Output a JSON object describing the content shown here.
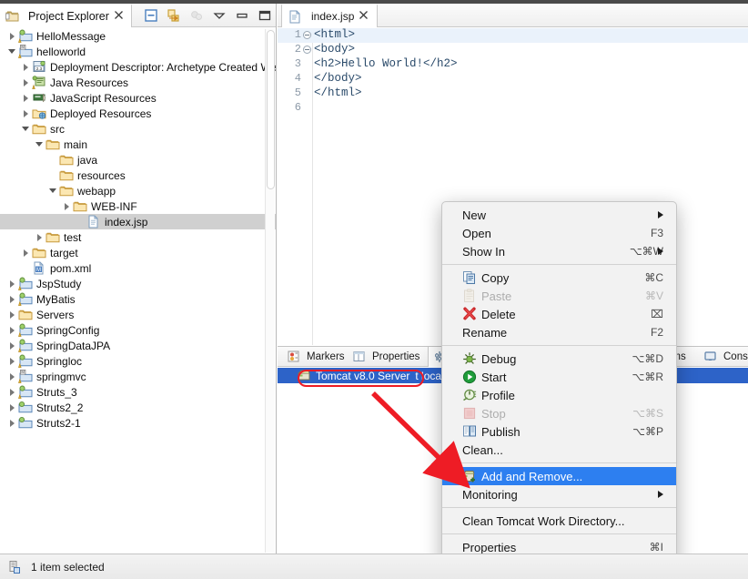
{
  "explorer": {
    "tab_title": "Project Explorer",
    "close_glyph": "✖",
    "tools": [
      "collapse-all-icon",
      "link-with-editor-icon",
      "focus-on-active-task-icon",
      "view-menu-icon",
      "minimize-icon",
      "maximize-icon"
    ],
    "tree": [
      {
        "label": "HelloMessage",
        "indent": 0,
        "arrow": "closed",
        "icon": "project-warning-icon",
        "selected": false
      },
      {
        "label": "helloworld",
        "indent": 0,
        "arrow": "open",
        "icon": "maven-project-icon",
        "selected": false
      },
      {
        "label": "Deployment Descriptor: Archetype Created We",
        "indent": 1,
        "arrow": "closed",
        "icon": "deployment-descriptor-icon",
        "selected": false
      },
      {
        "label": "Java Resources",
        "indent": 1,
        "arrow": "closed",
        "icon": "java-resources-icon",
        "selected": false
      },
      {
        "label": "JavaScript Resources",
        "indent": 1,
        "arrow": "closed",
        "icon": "javascript-resources-icon",
        "selected": false
      },
      {
        "label": "Deployed Resources",
        "indent": 1,
        "arrow": "closed",
        "icon": "deployed-resources-icon",
        "selected": false
      },
      {
        "label": "src",
        "indent": 1,
        "arrow": "open",
        "icon": "folder-icon",
        "selected": false
      },
      {
        "label": "main",
        "indent": 2,
        "arrow": "open",
        "icon": "folder-icon",
        "selected": false
      },
      {
        "label": "java",
        "indent": 3,
        "arrow": "none",
        "icon": "folder-icon",
        "selected": false
      },
      {
        "label": "resources",
        "indent": 3,
        "arrow": "none",
        "icon": "folder-icon",
        "selected": false
      },
      {
        "label": "webapp",
        "indent": 3,
        "arrow": "open",
        "icon": "folder-icon",
        "selected": false
      },
      {
        "label": "WEB-INF",
        "indent": 4,
        "arrow": "closed",
        "icon": "folder-icon",
        "selected": false
      },
      {
        "label": "index.jsp",
        "indent": 5,
        "arrow": "none",
        "icon": "jsp-file-icon",
        "selected": true
      },
      {
        "label": "test",
        "indent": 2,
        "arrow": "closed",
        "icon": "folder-icon",
        "selected": false
      },
      {
        "label": "target",
        "indent": 1,
        "arrow": "closed",
        "icon": "folder-icon",
        "selected": false
      },
      {
        "label": "pom.xml",
        "indent": 1,
        "arrow": "none",
        "icon": "maven-pom-icon",
        "selected": false
      },
      {
        "label": "JspStudy",
        "indent": 0,
        "arrow": "closed",
        "icon": "project-warning-icon",
        "selected": false
      },
      {
        "label": "MyBatis",
        "indent": 0,
        "arrow": "closed",
        "icon": "project-warning-icon",
        "selected": false
      },
      {
        "label": "Servers",
        "indent": 0,
        "arrow": "closed",
        "icon": "folder-icon",
        "selected": false
      },
      {
        "label": "SpringConfig",
        "indent": 0,
        "arrow": "closed",
        "icon": "project-warning-icon",
        "selected": false
      },
      {
        "label": "SpringDataJPA",
        "indent": 0,
        "arrow": "closed",
        "icon": "project-warning-icon",
        "selected": false
      },
      {
        "label": "Springloc",
        "indent": 0,
        "arrow": "closed",
        "icon": "project-warning-icon",
        "selected": false
      },
      {
        "label": "springmvc",
        "indent": 0,
        "arrow": "closed",
        "icon": "maven-project-icon",
        "selected": false
      },
      {
        "label": "Struts_3",
        "indent": 0,
        "arrow": "closed",
        "icon": "project-warning-icon",
        "selected": false
      },
      {
        "label": "Struts2_2",
        "indent": 0,
        "arrow": "closed",
        "icon": "project-icon",
        "selected": false
      },
      {
        "label": "Struts2-1",
        "indent": 0,
        "arrow": "closed",
        "icon": "project-icon",
        "selected": false
      }
    ]
  },
  "editor": {
    "tab_title": "index.jsp",
    "close_glyph": "✖",
    "lines": [
      {
        "num": "1",
        "fold": true,
        "text": "<html>",
        "highlight": true
      },
      {
        "num": "2",
        "fold": true,
        "text": "<body>",
        "highlight": false
      },
      {
        "num": "3",
        "fold": false,
        "text": "<h2>Hello World!</h2>",
        "highlight": false
      },
      {
        "num": "4",
        "fold": false,
        "text": "</body>",
        "highlight": false
      },
      {
        "num": "5",
        "fold": false,
        "text": "</html>",
        "highlight": false
      },
      {
        "num": "6",
        "fold": false,
        "text": "",
        "highlight": false
      }
    ]
  },
  "bottom_view": {
    "tabs": [
      {
        "label": "Markers",
        "icon": "markers-icon",
        "active": false
      },
      {
        "label": "Properties",
        "icon": "properties-icon",
        "active": false
      },
      {
        "label": "",
        "icon": "servers-icon",
        "active": true
      },
      {
        "label": "ems",
        "icon": "problems-icon",
        "active": false
      },
      {
        "label": "Cons",
        "icon": "console-icon",
        "active": false
      }
    ],
    "server_row": {
      "name": "Tomcat v8.0 Server",
      "state": "t loca",
      "icon": "tomcat-server-icon"
    }
  },
  "context_menu": {
    "items": [
      {
        "label": "New",
        "key": "",
        "icon": "",
        "submenu": true,
        "disabled": false,
        "highlighted": false
      },
      {
        "label": "Open",
        "key": "F3",
        "icon": "",
        "submenu": false,
        "disabled": false,
        "highlighted": false
      },
      {
        "label": "Show In",
        "key": "⌥⌘W",
        "icon": "",
        "submenu": true,
        "disabled": false,
        "highlighted": false
      },
      {
        "separator": true
      },
      {
        "label": "Copy",
        "key": "⌘C",
        "icon": "copy-icon",
        "submenu": false,
        "disabled": false,
        "highlighted": false
      },
      {
        "label": "Paste",
        "key": "⌘V",
        "icon": "paste-icon",
        "submenu": false,
        "disabled": true,
        "highlighted": false
      },
      {
        "label": "Delete",
        "key": "⌧",
        "icon": "delete-icon",
        "submenu": false,
        "disabled": false,
        "highlighted": false
      },
      {
        "label": "Rename",
        "key": "F2",
        "icon": "",
        "submenu": false,
        "disabled": false,
        "highlighted": false
      },
      {
        "separator": true
      },
      {
        "label": "Debug",
        "key": "⌥⌘D",
        "icon": "debug-icon",
        "submenu": false,
        "disabled": false,
        "highlighted": false
      },
      {
        "label": "Start",
        "key": "⌥⌘R",
        "icon": "start-icon",
        "submenu": false,
        "disabled": false,
        "highlighted": false
      },
      {
        "label": "Profile",
        "key": "",
        "icon": "profile-icon",
        "submenu": false,
        "disabled": false,
        "highlighted": false
      },
      {
        "label": "Stop",
        "key": "⌥⌘S",
        "icon": "stop-icon",
        "submenu": false,
        "disabled": true,
        "highlighted": false
      },
      {
        "label": "Publish",
        "key": "⌥⌘P",
        "icon": "publish-icon",
        "submenu": false,
        "disabled": false,
        "highlighted": false
      },
      {
        "label": "Clean...",
        "key": "",
        "icon": "",
        "submenu": false,
        "disabled": false,
        "highlighted": false
      },
      {
        "separator": true
      },
      {
        "label": "Add and Remove...",
        "key": "",
        "icon": "add-remove-icon",
        "submenu": false,
        "disabled": false,
        "highlighted": true
      },
      {
        "label": "Monitoring",
        "key": "",
        "icon": "",
        "submenu": true,
        "disabled": false,
        "highlighted": false
      },
      {
        "separator": true
      },
      {
        "label": "Clean Tomcat Work Directory...",
        "key": "",
        "icon": "",
        "submenu": false,
        "disabled": false,
        "highlighted": false
      },
      {
        "separator": true
      },
      {
        "label": "Properties",
        "key": "⌘I",
        "icon": "",
        "submenu": false,
        "disabled": false,
        "highlighted": false
      }
    ]
  },
  "status_bar": {
    "text": "1 item selected",
    "icon": "selection-icon"
  },
  "annotations": {
    "oval_color": "#ee1c25",
    "arrow_color": "#ee1c25"
  }
}
